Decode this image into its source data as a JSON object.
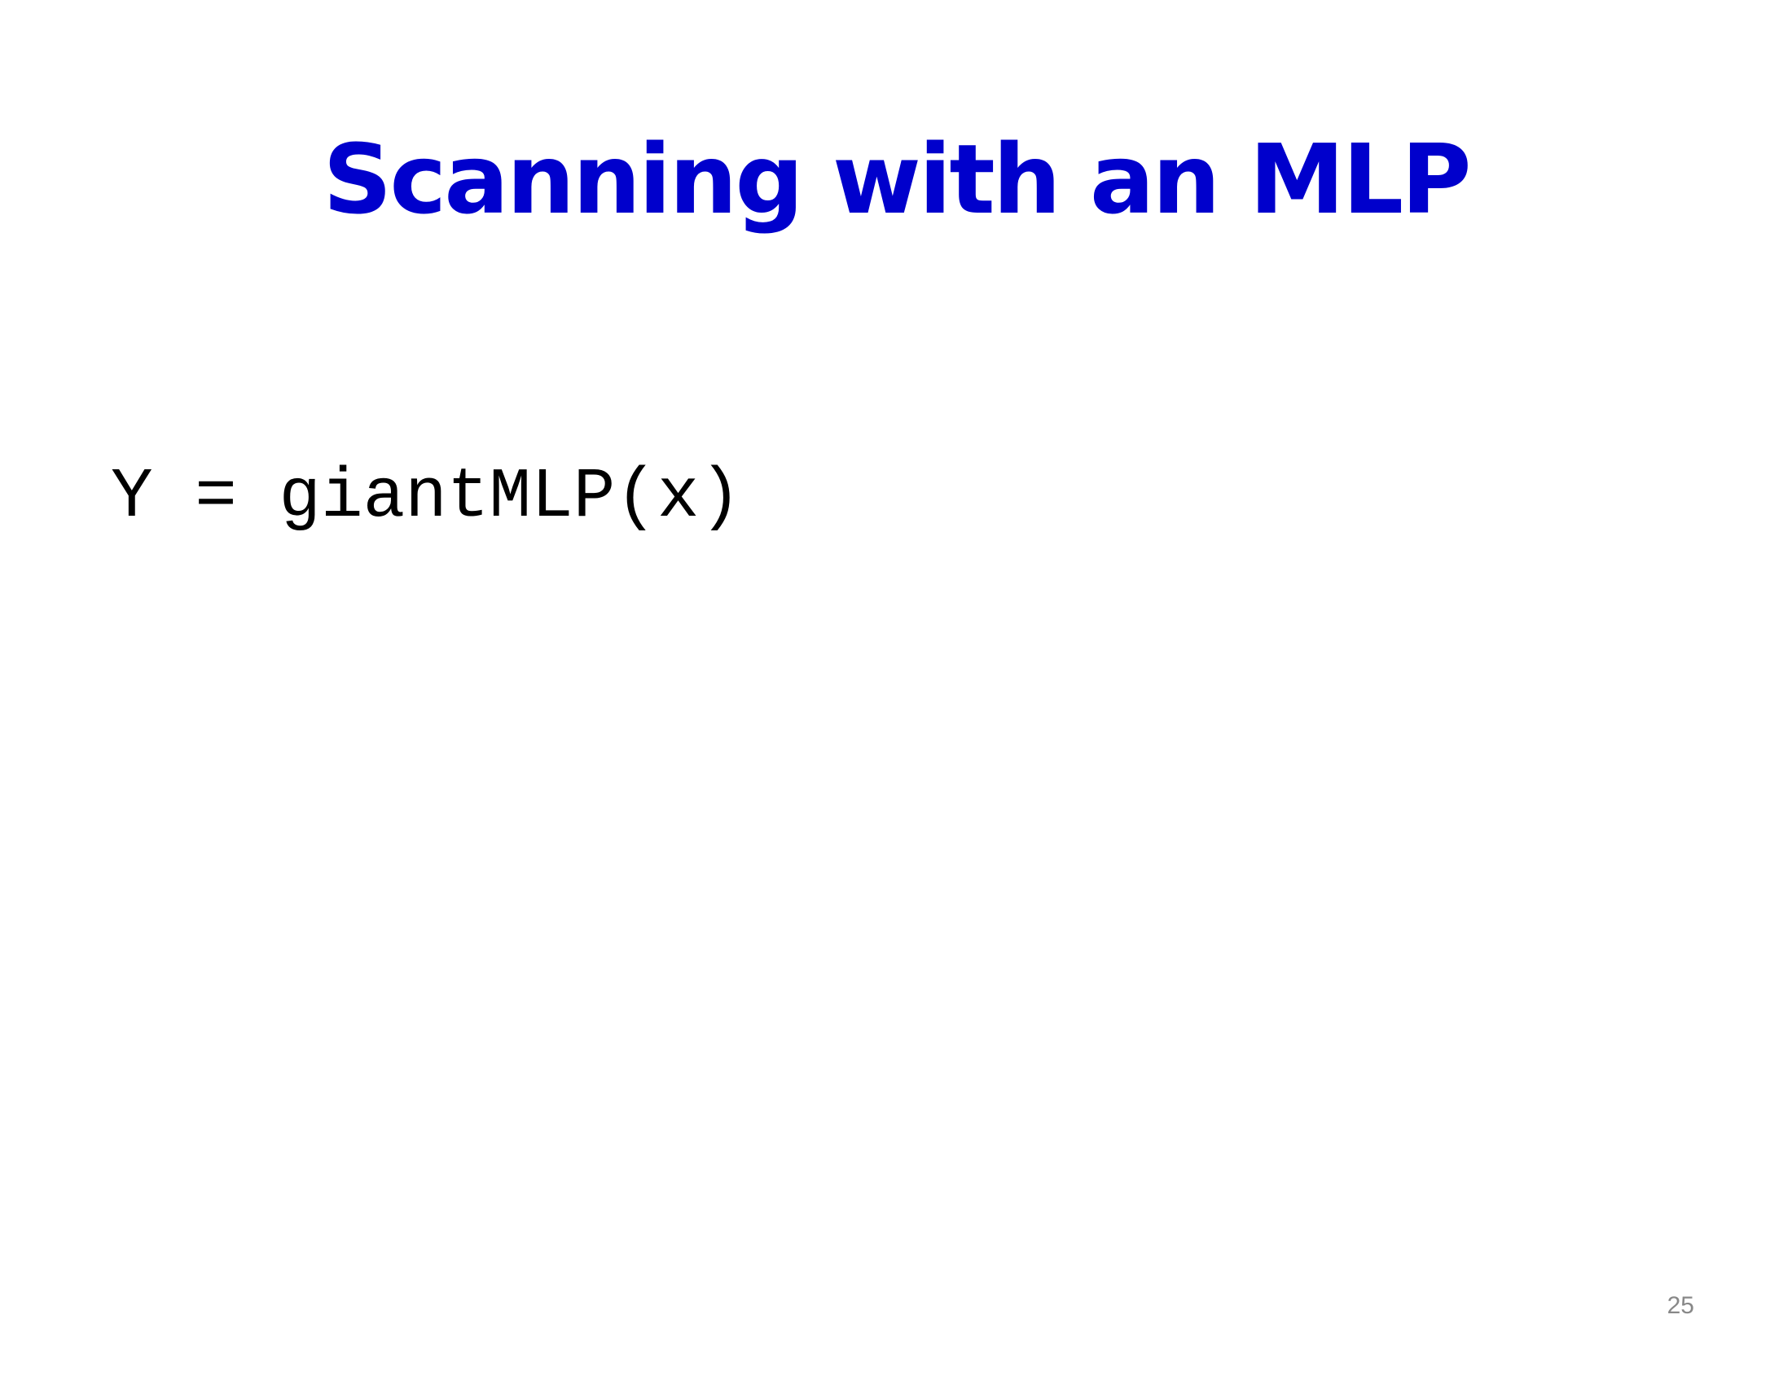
{
  "slide": {
    "title": "Scanning with an MLP",
    "code": "Y = giantMLP(x)",
    "page_number": "25"
  },
  "colors": {
    "title": "#0000cc",
    "code": "#000000",
    "page_number": "#888888",
    "background": "#ffffff"
  }
}
